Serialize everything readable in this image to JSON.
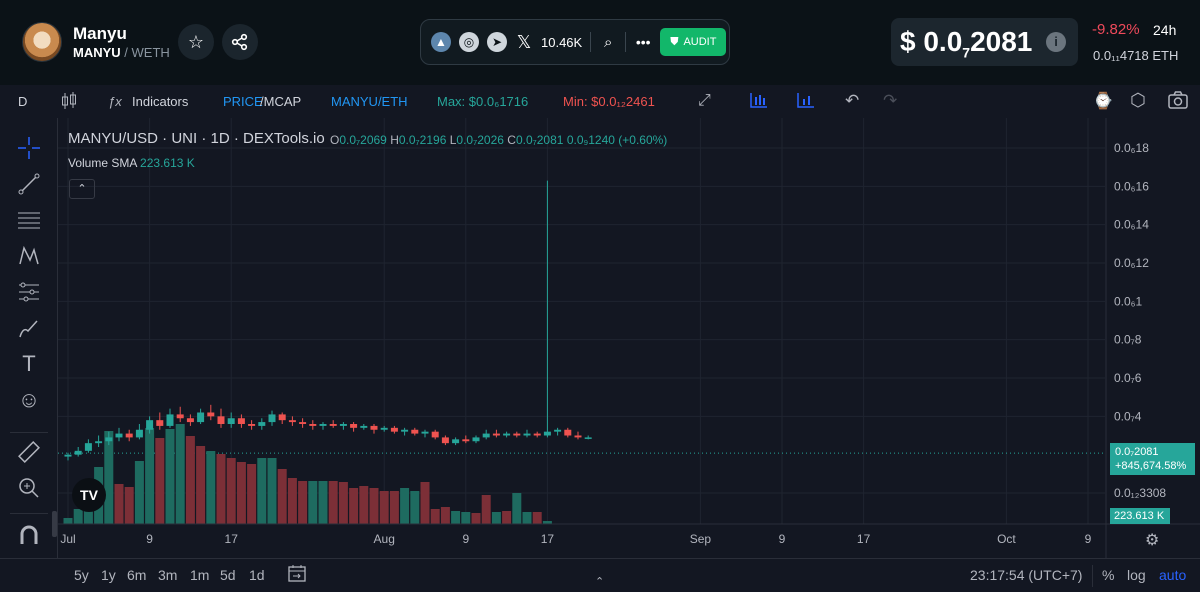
{
  "header": {
    "token_name": "Manyu",
    "token_symbol": "MANYU",
    "pair_quote": "/ WETH",
    "followers": "10.46K",
    "audit_label": "AUDIT",
    "price_prefix": "$ 0.0",
    "price_sub": "7",
    "price_tail": "2081",
    "change": "-9.82%",
    "period": "24h",
    "eth_price": "0.0₁₁4718  ETH",
    "icons": [
      "star-icon",
      "share-icon",
      "dextools-icon",
      "globe-icon",
      "telegram-icon",
      "x-icon",
      "search-icon",
      "more-icon",
      "shield-icon",
      "info-icon"
    ]
  },
  "toolbar": {
    "interval": "D",
    "indicators": "Indicators",
    "price_label": "PRICE",
    "mcap_label": "/MCAP",
    "pair_label": "MANYU/ETH",
    "max_label": "Max: $0.0₆1716",
    "min_label": "Min: $0.0₁₂2461"
  },
  "legend": {
    "title": "MANYU/USD · UNI · 1D · DEXTools.io",
    "o_key": "O",
    "o_val": "0.0₇2069",
    "h_key": "H",
    "h_val": "0.0₇2196",
    "l_key": "L",
    "l_val": "0.0₇2026",
    "c_key": "C",
    "c_val": "0.0₇2081",
    "change": "0.0₉1240 (+0.60%)",
    "volume_label": "Volume SMA",
    "volume_value": "223.613 K"
  },
  "price_tag": {
    "price": "0.0₇2081",
    "pct": "+845,674.58%"
  },
  "volume_tag": "223.613 K",
  "timeframes": [
    "5y",
    "1y",
    "6m",
    "3m",
    "1m",
    "5d",
    "1d"
  ],
  "clock": "23:17:54 (UTC+7)",
  "scale_options": [
    "%",
    "log",
    "auto"
  ],
  "colors": {
    "up": "#26a69a",
    "down": "#ef5350",
    "vol_up": "#1e6b60",
    "vol_down": "#7c2f37",
    "accent": "#2962ff"
  },
  "chart_data": {
    "type": "candlestick",
    "title": "MANYU/USD · UNI · 1D · DEXTools.io",
    "y_ticks": [
      "0.0₆18",
      "0.0₆16",
      "0.0₆14",
      "0.0₆12",
      "0.0₆1",
      "0.0₇8",
      "0.0₇6",
      "0.0₇4",
      "0.0₁₂3308"
    ],
    "y_tick_values": [
      1.8,
      1.6,
      1.4,
      1.2,
      1.0,
      0.8,
      0.6,
      0.4,
      0.0
    ],
    "y_unit": "×1e-6 USD",
    "ylim": [
      0.0,
      1.9
    ],
    "x_ticks": [
      "Jul",
      "9",
      "17",
      "Aug",
      "9",
      "17",
      "Sep",
      "9",
      "17",
      "Oct",
      "9"
    ],
    "x_tick_days": [
      0,
      8,
      16,
      31,
      39,
      47,
      62,
      70,
      78,
      92,
      100
    ],
    "x_range_days": [
      0,
      104
    ],
    "x_start": "Jul 1",
    "candles": [
      {
        "d": 0,
        "o": 0.19,
        "h": 0.21,
        "l": 0.17,
        "c": 0.2
      },
      {
        "d": 1,
        "o": 0.2,
        "h": 0.24,
        "l": 0.19,
        "c": 0.22
      },
      {
        "d": 2,
        "o": 0.22,
        "h": 0.28,
        "l": 0.21,
        "c": 0.26
      },
      {
        "d": 3,
        "o": 0.26,
        "h": 0.3,
        "l": 0.24,
        "c": 0.27
      },
      {
        "d": 4,
        "o": 0.27,
        "h": 0.32,
        "l": 0.25,
        "c": 0.29
      },
      {
        "d": 5,
        "o": 0.29,
        "h": 0.34,
        "l": 0.27,
        "c": 0.31
      },
      {
        "d": 6,
        "o": 0.31,
        "h": 0.33,
        "l": 0.27,
        "c": 0.29
      },
      {
        "d": 7,
        "o": 0.29,
        "h": 0.36,
        "l": 0.28,
        "c": 0.33
      },
      {
        "d": 8,
        "o": 0.33,
        "h": 0.4,
        "l": 0.31,
        "c": 0.38
      },
      {
        "d": 9,
        "o": 0.38,
        "h": 0.42,
        "l": 0.33,
        "c": 0.35
      },
      {
        "d": 10,
        "o": 0.35,
        "h": 0.44,
        "l": 0.34,
        "c": 0.41
      },
      {
        "d": 11,
        "o": 0.41,
        "h": 0.45,
        "l": 0.37,
        "c": 0.39
      },
      {
        "d": 12,
        "o": 0.39,
        "h": 0.41,
        "l": 0.35,
        "c": 0.37
      },
      {
        "d": 13,
        "o": 0.37,
        "h": 0.44,
        "l": 0.36,
        "c": 0.42
      },
      {
        "d": 14,
        "o": 0.42,
        "h": 0.46,
        "l": 0.38,
        "c": 0.4
      },
      {
        "d": 15,
        "o": 0.4,
        "h": 0.44,
        "l": 0.34,
        "c": 0.36
      },
      {
        "d": 16,
        "o": 0.36,
        "h": 0.42,
        "l": 0.34,
        "c": 0.39
      },
      {
        "d": 17,
        "o": 0.39,
        "h": 0.41,
        "l": 0.34,
        "c": 0.36
      },
      {
        "d": 18,
        "o": 0.36,
        "h": 0.38,
        "l": 0.33,
        "c": 0.35
      },
      {
        "d": 19,
        "o": 0.35,
        "h": 0.39,
        "l": 0.33,
        "c": 0.37
      },
      {
        "d": 20,
        "o": 0.37,
        "h": 0.43,
        "l": 0.35,
        "c": 0.41
      },
      {
        "d": 21,
        "o": 0.41,
        "h": 0.42,
        "l": 0.36,
        "c": 0.38
      },
      {
        "d": 22,
        "o": 0.38,
        "h": 0.4,
        "l": 0.35,
        "c": 0.37
      },
      {
        "d": 23,
        "o": 0.37,
        "h": 0.39,
        "l": 0.34,
        "c": 0.36
      },
      {
        "d": 24,
        "o": 0.36,
        "h": 0.38,
        "l": 0.33,
        "c": 0.35
      },
      {
        "d": 25,
        "o": 0.35,
        "h": 0.37,
        "l": 0.33,
        "c": 0.36
      },
      {
        "d": 26,
        "o": 0.36,
        "h": 0.38,
        "l": 0.34,
        "c": 0.35
      },
      {
        "d": 27,
        "o": 0.35,
        "h": 0.37,
        "l": 0.33,
        "c": 0.36
      },
      {
        "d": 28,
        "o": 0.36,
        "h": 0.37,
        "l": 0.32,
        "c": 0.34
      },
      {
        "d": 29,
        "o": 0.34,
        "h": 0.36,
        "l": 0.33,
        "c": 0.35
      },
      {
        "d": 30,
        "o": 0.35,
        "h": 0.36,
        "l": 0.31,
        "c": 0.33
      },
      {
        "d": 31,
        "o": 0.33,
        "h": 0.35,
        "l": 0.32,
        "c": 0.34
      },
      {
        "d": 32,
        "o": 0.34,
        "h": 0.35,
        "l": 0.31,
        "c": 0.32
      },
      {
        "d": 33,
        "o": 0.32,
        "h": 0.34,
        "l": 0.3,
        "c": 0.33
      },
      {
        "d": 34,
        "o": 0.33,
        "h": 0.34,
        "l": 0.3,
        "c": 0.31
      },
      {
        "d": 35,
        "o": 0.31,
        "h": 0.33,
        "l": 0.29,
        "c": 0.32
      },
      {
        "d": 36,
        "o": 0.32,
        "h": 0.33,
        "l": 0.28,
        "c": 0.29
      },
      {
        "d": 37,
        "o": 0.29,
        "h": 0.3,
        "l": 0.25,
        "c": 0.26
      },
      {
        "d": 38,
        "o": 0.26,
        "h": 0.29,
        "l": 0.25,
        "c": 0.28
      },
      {
        "d": 39,
        "o": 0.28,
        "h": 0.3,
        "l": 0.26,
        "c": 0.27
      },
      {
        "d": 40,
        "o": 0.27,
        "h": 0.3,
        "l": 0.26,
        "c": 0.29
      },
      {
        "d": 41,
        "o": 0.29,
        "h": 0.33,
        "l": 0.28,
        "c": 0.31
      },
      {
        "d": 42,
        "o": 0.31,
        "h": 0.33,
        "l": 0.29,
        "c": 0.3
      },
      {
        "d": 43,
        "o": 0.3,
        "h": 0.32,
        "l": 0.29,
        "c": 0.31
      },
      {
        "d": 44,
        "o": 0.31,
        "h": 0.32,
        "l": 0.29,
        "c": 0.3
      },
      {
        "d": 45,
        "o": 0.3,
        "h": 0.33,
        "l": 0.29,
        "c": 0.31
      },
      {
        "d": 46,
        "o": 0.31,
        "h": 0.32,
        "l": 0.29,
        "c": 0.3
      },
      {
        "d": 47,
        "o": 0.3,
        "h": 1.63,
        "l": 0.29,
        "c": 0.32
      },
      {
        "d": 48,
        "o": 0.32,
        "h": 0.34,
        "l": 0.3,
        "c": 0.33
      },
      {
        "d": 49,
        "o": 0.33,
        "h": 0.34,
        "l": 0.29,
        "c": 0.3
      },
      {
        "d": 50,
        "o": 0.3,
        "h": 0.32,
        "l": 0.28,
        "c": 0.29
      },
      {
        "d": 51,
        "o": 0.29,
        "h": 0.3,
        "l": 0.28,
        "c": 0.29
      }
    ],
    "volume": [
      {
        "d": 0,
        "v": 0.06,
        "up": true
      },
      {
        "d": 1,
        "v": 0.15,
        "up": true
      },
      {
        "d": 2,
        "v": 0.34,
        "up": true
      },
      {
        "d": 3,
        "v": 0.57,
        "up": true
      },
      {
        "d": 4,
        "v": 0.93,
        "up": true
      },
      {
        "d": 5,
        "v": 0.4,
        "up": false
      },
      {
        "d": 6,
        "v": 0.37,
        "up": false
      },
      {
        "d": 7,
        "v": 0.63,
        "up": true
      },
      {
        "d": 8,
        "v": 0.96,
        "up": true
      },
      {
        "d": 9,
        "v": 0.86,
        "up": false
      },
      {
        "d": 10,
        "v": 0.95,
        "up": true
      },
      {
        "d": 11,
        "v": 1.0,
        "up": true
      },
      {
        "d": 12,
        "v": 0.88,
        "up": false
      },
      {
        "d": 13,
        "v": 0.78,
        "up": false
      },
      {
        "d": 14,
        "v": 0.73,
        "up": true
      },
      {
        "d": 15,
        "v": 0.7,
        "up": false
      },
      {
        "d": 16,
        "v": 0.66,
        "up": false
      },
      {
        "d": 17,
        "v": 0.62,
        "up": false
      },
      {
        "d": 18,
        "v": 0.6,
        "up": false
      },
      {
        "d": 19,
        "v": 0.66,
        "up": true
      },
      {
        "d": 20,
        "v": 0.66,
        "up": true
      },
      {
        "d": 21,
        "v": 0.55,
        "up": false
      },
      {
        "d": 22,
        "v": 0.46,
        "up": false
      },
      {
        "d": 23,
        "v": 0.43,
        "up": false
      },
      {
        "d": 24,
        "v": 0.43,
        "up": true
      },
      {
        "d": 25,
        "v": 0.43,
        "up": true
      },
      {
        "d": 26,
        "v": 0.43,
        "up": false
      },
      {
        "d": 27,
        "v": 0.42,
        "up": false
      },
      {
        "d": 28,
        "v": 0.36,
        "up": false
      },
      {
        "d": 29,
        "v": 0.38,
        "up": false
      },
      {
        "d": 30,
        "v": 0.36,
        "up": false
      },
      {
        "d": 31,
        "v": 0.33,
        "up": false
      },
      {
        "d": 32,
        "v": 0.33,
        "up": false
      },
      {
        "d": 33,
        "v": 0.36,
        "up": true
      },
      {
        "d": 34,
        "v": 0.33,
        "up": true
      },
      {
        "d": 35,
        "v": 0.42,
        "up": false
      },
      {
        "d": 36,
        "v": 0.15,
        "up": false
      },
      {
        "d": 37,
        "v": 0.17,
        "up": false
      },
      {
        "d": 38,
        "v": 0.13,
        "up": true
      },
      {
        "d": 39,
        "v": 0.12,
        "up": true
      },
      {
        "d": 40,
        "v": 0.11,
        "up": false
      },
      {
        "d": 41,
        "v": 0.29,
        "up": false
      },
      {
        "d": 42,
        "v": 0.12,
        "up": true
      },
      {
        "d": 43,
        "v": 0.13,
        "up": false
      },
      {
        "d": 44,
        "v": 0.31,
        "up": true
      },
      {
        "d": 45,
        "v": 0.12,
        "up": true
      },
      {
        "d": 46,
        "v": 0.12,
        "up": false
      },
      {
        "d": 47,
        "v": 0.03,
        "up": true
      }
    ],
    "last_price": 0.2081,
    "grid": true,
    "legend_position": "top-left"
  }
}
